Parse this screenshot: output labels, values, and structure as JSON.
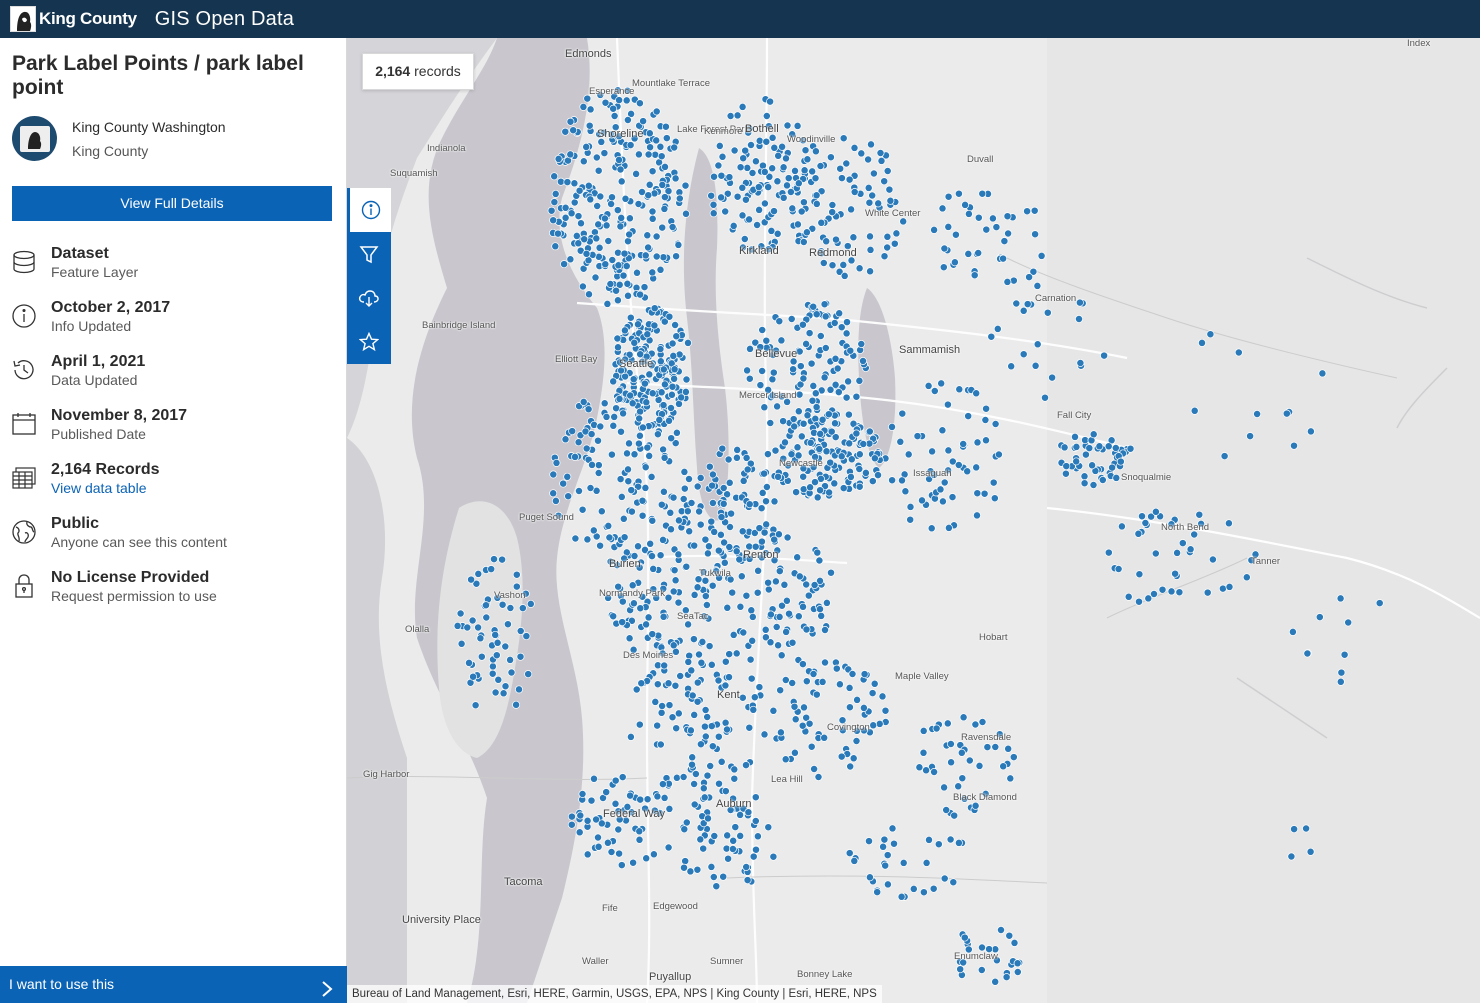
{
  "header": {
    "logo_text": "King County",
    "site_title": "GIS Open Data"
  },
  "item": {
    "title": "Park Label Points / park label point",
    "owner_org": "King County Washington",
    "owner_sub": "King County",
    "view_details_label": "View Full Details"
  },
  "info": [
    {
      "main": "Dataset",
      "secondary": "Feature Layer",
      "icon": "database-icon"
    },
    {
      "main": "October 2, 2017",
      "secondary": "Info Updated",
      "icon": "info-icon"
    },
    {
      "main": "April 1, 2021",
      "secondary": "Data Updated",
      "icon": "history-icon"
    },
    {
      "main": "November 8, 2017",
      "secondary": "Published Date",
      "icon": "calendar-icon"
    },
    {
      "main": "2,164 Records",
      "secondary": "View data table",
      "icon": "table-icon"
    },
    {
      "main": "Public",
      "secondary": "Anyone can see this content",
      "icon": "globe-icon"
    },
    {
      "main": "No License Provided",
      "secondary": "Request permission to use",
      "icon": "lock-icon"
    }
  ],
  "use_bar_label": "I want to use this",
  "map": {
    "record_count": "2,164",
    "record_label": "records",
    "attribution": "Bureau of Land Management, Esri, HERE, Garmin, USGS, EPA, NPS | King County | Esri, HERE, NPS",
    "tools": [
      "info-icon",
      "filter-icon",
      "download-icon",
      "star-icon"
    ],
    "point_color": "#2a79b8",
    "places": [
      {
        "name": "Edmonds"
      },
      {
        "name": "Mountlake Terrace"
      },
      {
        "name": "Esperance"
      },
      {
        "name": "Shoreline"
      },
      {
        "name": "Lake Forest Park"
      },
      {
        "name": "Kenmore"
      },
      {
        "name": "Bothell"
      },
      {
        "name": "Woodinville"
      },
      {
        "name": "Duvall"
      },
      {
        "name": "Indianola"
      },
      {
        "name": "Suquamish"
      },
      {
        "name": "Kirkland"
      },
      {
        "name": "Redmond"
      },
      {
        "name": "White Center"
      },
      {
        "name": "Carnation"
      },
      {
        "name": "Bainbridge Island"
      },
      {
        "name": "Elliott Bay"
      },
      {
        "name": "Seattle"
      },
      {
        "name": "Bellevue"
      },
      {
        "name": "Sammamish"
      },
      {
        "name": "Mercer Island"
      },
      {
        "name": "Fall City"
      },
      {
        "name": "Newcastle"
      },
      {
        "name": "Issaquah"
      },
      {
        "name": "Snoqualmie"
      },
      {
        "name": "North Bend"
      },
      {
        "name": "Puget Sound"
      },
      {
        "name": "Renton"
      },
      {
        "name": "Tanner"
      },
      {
        "name": "Burien"
      },
      {
        "name": "Tukwila"
      },
      {
        "name": "Vashon"
      },
      {
        "name": "Normandy Park"
      },
      {
        "name": "SeaTac"
      },
      {
        "name": "Olalla"
      },
      {
        "name": "Hobart"
      },
      {
        "name": "Des Moines"
      },
      {
        "name": "Maple Valley"
      },
      {
        "name": "Kent"
      },
      {
        "name": "Covington"
      },
      {
        "name": "Ravensdale"
      },
      {
        "name": "Gig Harbor"
      },
      {
        "name": "Lea Hill"
      },
      {
        "name": "Black Diamond"
      },
      {
        "name": "Auburn"
      },
      {
        "name": "Federal Way"
      },
      {
        "name": "Tacoma"
      },
      {
        "name": "Fife"
      },
      {
        "name": "Edgewood"
      },
      {
        "name": "University Place"
      },
      {
        "name": "Waller"
      },
      {
        "name": "Sumner"
      },
      {
        "name": "Bonney Lake"
      },
      {
        "name": "Puyallup"
      },
      {
        "name": "Enumclaw"
      },
      {
        "name": "Index"
      }
    ]
  }
}
